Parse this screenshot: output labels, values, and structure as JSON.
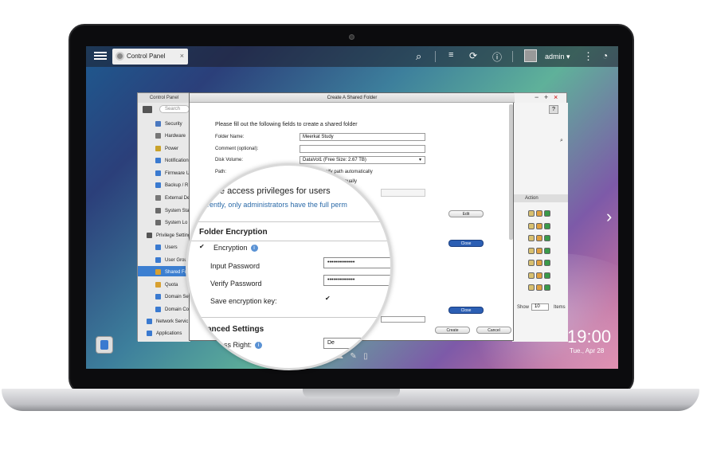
{
  "desktop": {
    "taskbar_tab_label": "Control Panel",
    "user_label": "admin ▾",
    "clock": "19:00",
    "date": "Tue., Apr 28"
  },
  "control_panel": {
    "title": "Control Panel",
    "search_placeholder": "Search",
    "sidebar_items": [
      {
        "label": "Security",
        "icon": "lock-icon"
      },
      {
        "label": "Hardware",
        "icon": "chip-icon"
      },
      {
        "label": "Power",
        "icon": "power-icon"
      },
      {
        "label": "Notification",
        "icon": "bell-icon"
      },
      {
        "label": "Firmware U",
        "icon": "firmware-icon"
      },
      {
        "label": "Backup / R",
        "icon": "backup-icon"
      },
      {
        "label": "External De",
        "icon": "usb-icon"
      },
      {
        "label": "System Sta",
        "icon": "monitor-icon"
      },
      {
        "label": "System Lo",
        "icon": "log-icon"
      },
      {
        "label": "Privilege Setting",
        "icon": "person-icon"
      },
      {
        "label": "Users",
        "icon": "user-icon"
      },
      {
        "label": "User Group",
        "icon": "group-icon"
      },
      {
        "label": "Shared Fo",
        "icon": "folder-icon"
      },
      {
        "label": "Quota",
        "icon": "quota-icon"
      },
      {
        "label": "Domain Se",
        "icon": "domain-icon"
      },
      {
        "label": "Domain Co",
        "icon": "domain-controller-icon"
      },
      {
        "label": "Network Servic",
        "icon": "globe-icon"
      },
      {
        "label": "Applications",
        "icon": "apps-icon"
      }
    ],
    "action_header": "Action",
    "show_label": "Show",
    "show_value": "10",
    "items_label": "Items"
  },
  "dialog": {
    "title": "Create A Shared Folder",
    "intro": "Please fill out the following fields to create a shared folder",
    "folder_name_label": "Folder Name:",
    "folder_name_value": "Meerkat Study",
    "comment_label": "Comment (optional):",
    "comment_value": "",
    "disk_volume_label": "Disk Volume:",
    "disk_volume_value": "DataVol1 (Free Size: 2.67 TB)",
    "path_label": "Path:",
    "path_auto": "Specify path automatically",
    "path_manual": "manually",
    "edit_button": "Edit",
    "close_button_1": "Close",
    "close_button_2": "Close",
    "create_button": "Create",
    "cancel_button": "Cancel"
  },
  "magnifier": {
    "access_heading": "gure access privileges for users",
    "access_note": "rently, only administrators have the full perm",
    "encryption_heading": "Folder Encryption",
    "encryption_label": "Encryption",
    "input_password_label": "Input Password",
    "input_password_value": "••••••••••••••",
    "verify_password_label": "Verify Password",
    "verify_password_value": "••••••••••••••",
    "save_key_label": "Save encryption key:",
    "advanced_heading": "anced Settings",
    "access_right_label": "ess Right:",
    "access_right_value": "De"
  }
}
